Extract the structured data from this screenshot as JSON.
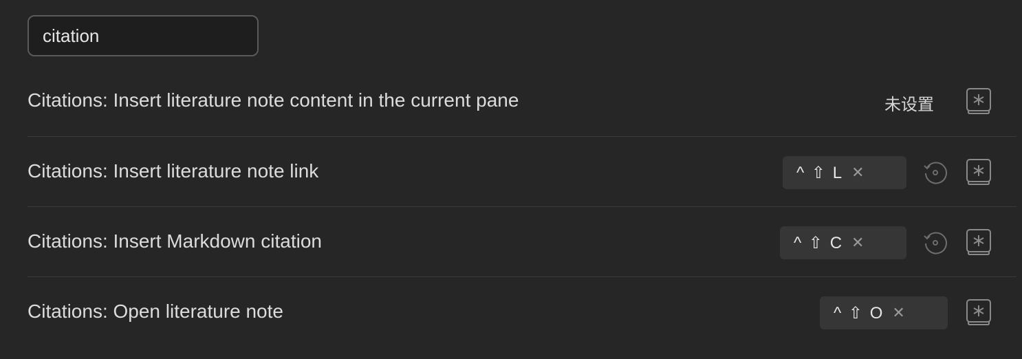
{
  "search": {
    "value": "citation",
    "placeholder": ""
  },
  "commands": [
    {
      "label": "Citations: Insert literature note content in the current pane",
      "status": "未设置",
      "hotkey": null,
      "icons": [
        "add-hotkey-icon"
      ]
    },
    {
      "label": "Citations: Insert literature note link",
      "status": "",
      "hotkey": {
        "keys": "^ ⇧ L",
        "remove": "✕"
      },
      "icons": [
        "restore-default-icon",
        "add-hotkey-icon"
      ]
    },
    {
      "label": "Citations: Insert Markdown citation",
      "status": "",
      "hotkey": {
        "keys": "^ ⇧ C",
        "remove": "✕"
      },
      "icons": [
        "restore-default-icon",
        "add-hotkey-icon"
      ]
    },
    {
      "label": "Citations: Open literature note",
      "status": "",
      "hotkey": {
        "keys": "^ ⇧ O",
        "remove": "✕"
      },
      "icons": [
        "add-hotkey-icon"
      ]
    }
  ],
  "colors": {
    "background": "#262626",
    "text": "#dcdcdc",
    "hotkey_chip": "#363636",
    "divider": "#3a3a3a",
    "icon": "#8a8a8a"
  }
}
